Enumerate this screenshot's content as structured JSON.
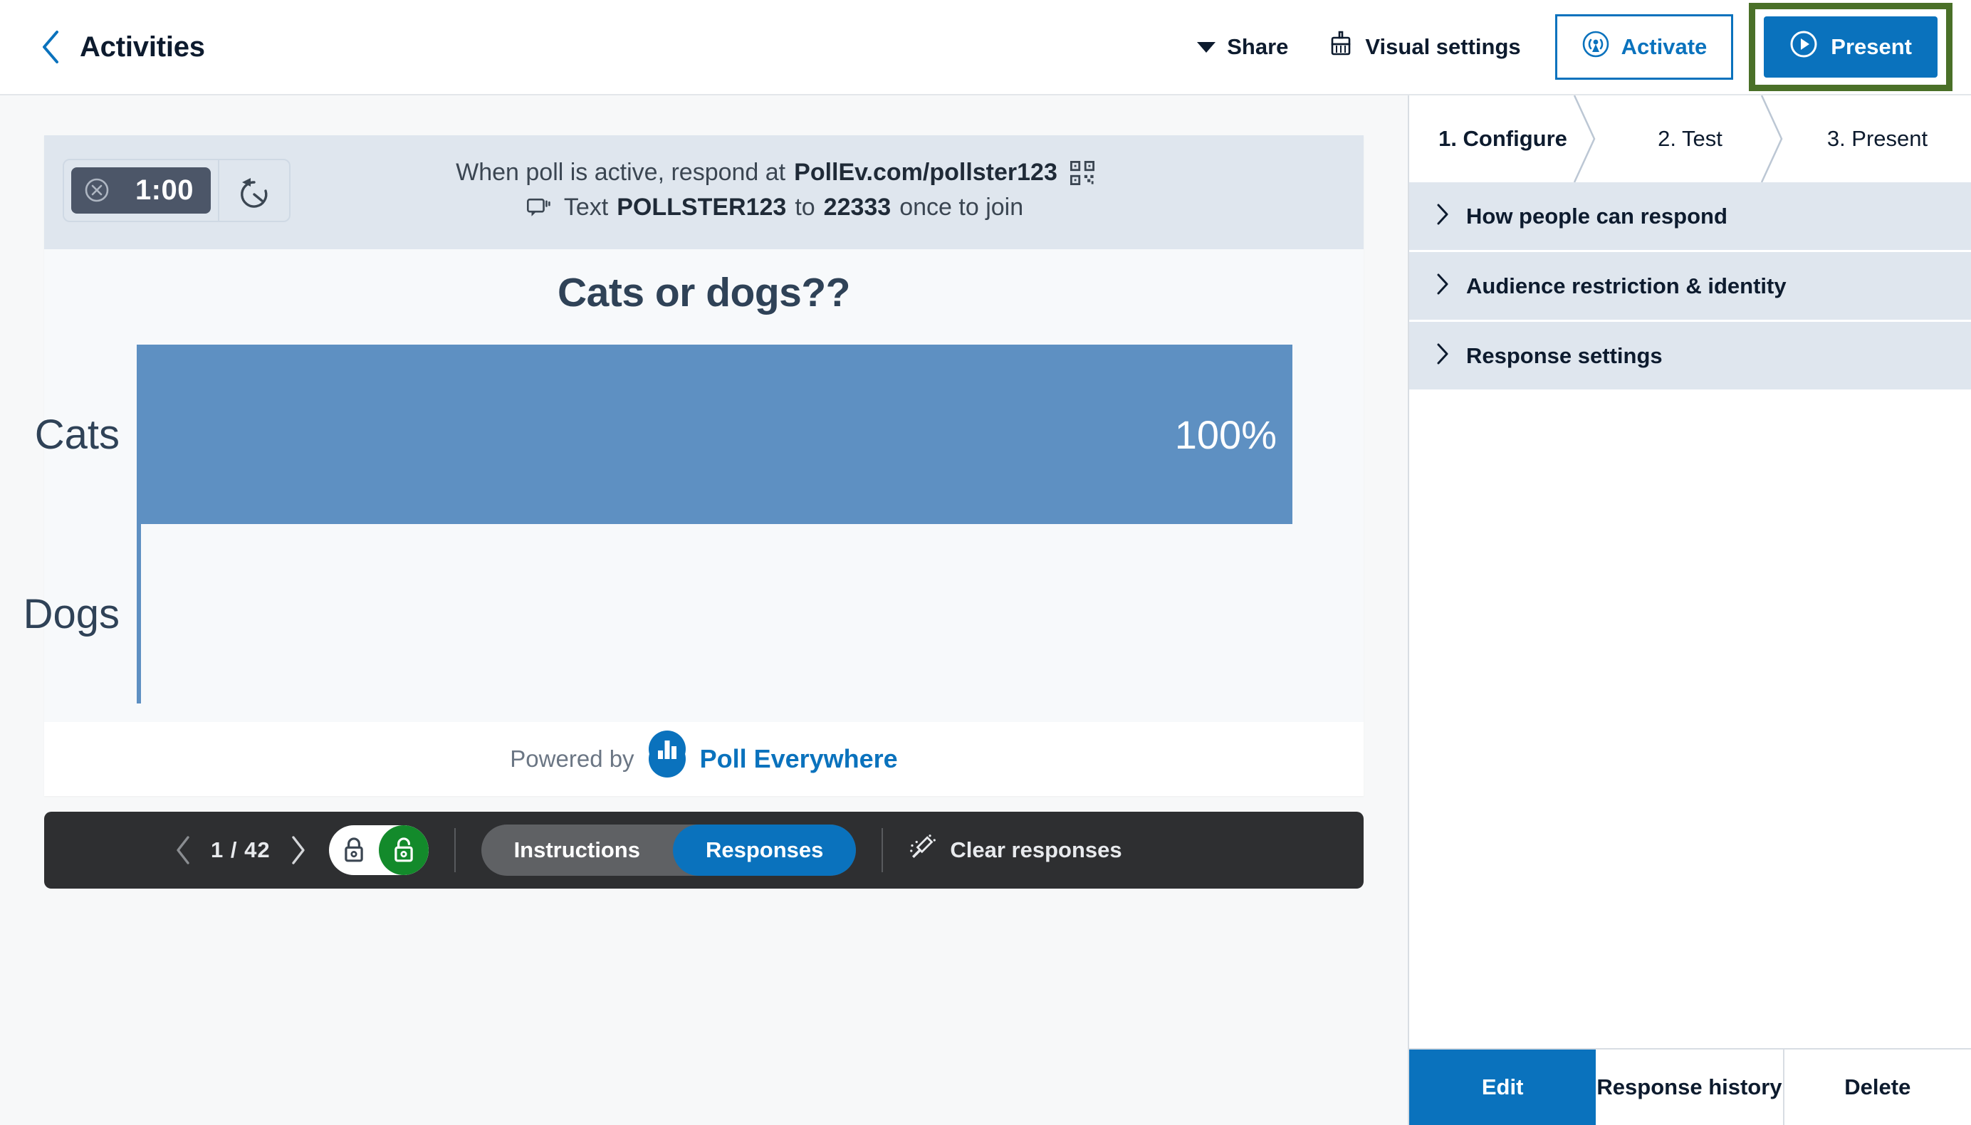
{
  "topbar": {
    "back_icon": "chevron-left-icon",
    "title": "Activities",
    "share_label": "Share",
    "visual_settings_label": "Visual settings",
    "activate_label": "Activate",
    "present_label": "Present",
    "highlight_color": "#4a7028",
    "accent_color": "#0a72bd"
  },
  "poll": {
    "timer": {
      "value": "1:00",
      "cancel_icon": "x-circle-icon",
      "reset_icon": "timer-reset-icon"
    },
    "instructions": {
      "line1_prefix": "When poll is active, respond at ",
      "line1_url": "PollEv.com/pollster123",
      "qr_icon": "qr-code-icon",
      "sms_icon": "sms-message-icon",
      "line2_prefix": "Text ",
      "line2_keyword": "POLLSTER123",
      "line2_middle": " to ",
      "line2_shortcode": "22333",
      "line2_suffix": " once to join"
    },
    "footer": {
      "powered_by": "Powered by",
      "brand": "Poll Everywhere",
      "logo_icon": "poll-everywhere-logo-icon"
    }
  },
  "chart_data": {
    "type": "bar",
    "orientation": "horizontal",
    "title": "Cats or dogs??",
    "categories": [
      "Cats",
      "Dogs"
    ],
    "values": [
      100,
      0
    ],
    "value_labels": [
      "100%",
      ""
    ],
    "xlabel": "",
    "ylabel": "",
    "xlim": [
      0,
      100
    ],
    "grid": false,
    "legend": false,
    "bar_color": "#5e90c2",
    "axis_color": "#5e90c2",
    "title_color": "#2f4257",
    "label_color": "#2f4257"
  },
  "control_bar": {
    "prev_icon": "chevron-left-icon",
    "next_icon": "chevron-right-icon",
    "page_count": "1 / 42",
    "lock_closed_icon": "lock-closed-icon",
    "lock_open_icon": "lock-open-icon",
    "lock_state": "unlocked",
    "segments": [
      {
        "label": "Instructions",
        "active": false
      },
      {
        "label": "Responses",
        "active": true
      }
    ],
    "clear_icon": "broom-icon",
    "clear_label": "Clear responses"
  },
  "sidebar": {
    "steps": [
      {
        "label": "1. Configure",
        "active": true
      },
      {
        "label": "2. Test",
        "active": false
      },
      {
        "label": "3. Present",
        "active": false
      }
    ],
    "accordion": [
      {
        "label": "How people can respond",
        "icon": "chevron-right-icon"
      },
      {
        "label": "Audience restriction & identity",
        "icon": "chevron-right-icon"
      },
      {
        "label": "Response settings",
        "icon": "chevron-right-icon"
      }
    ],
    "actions": [
      {
        "label": "Edit",
        "primary": true
      },
      {
        "label": "Response history",
        "primary": false
      },
      {
        "label": "Delete",
        "primary": false
      }
    ]
  }
}
